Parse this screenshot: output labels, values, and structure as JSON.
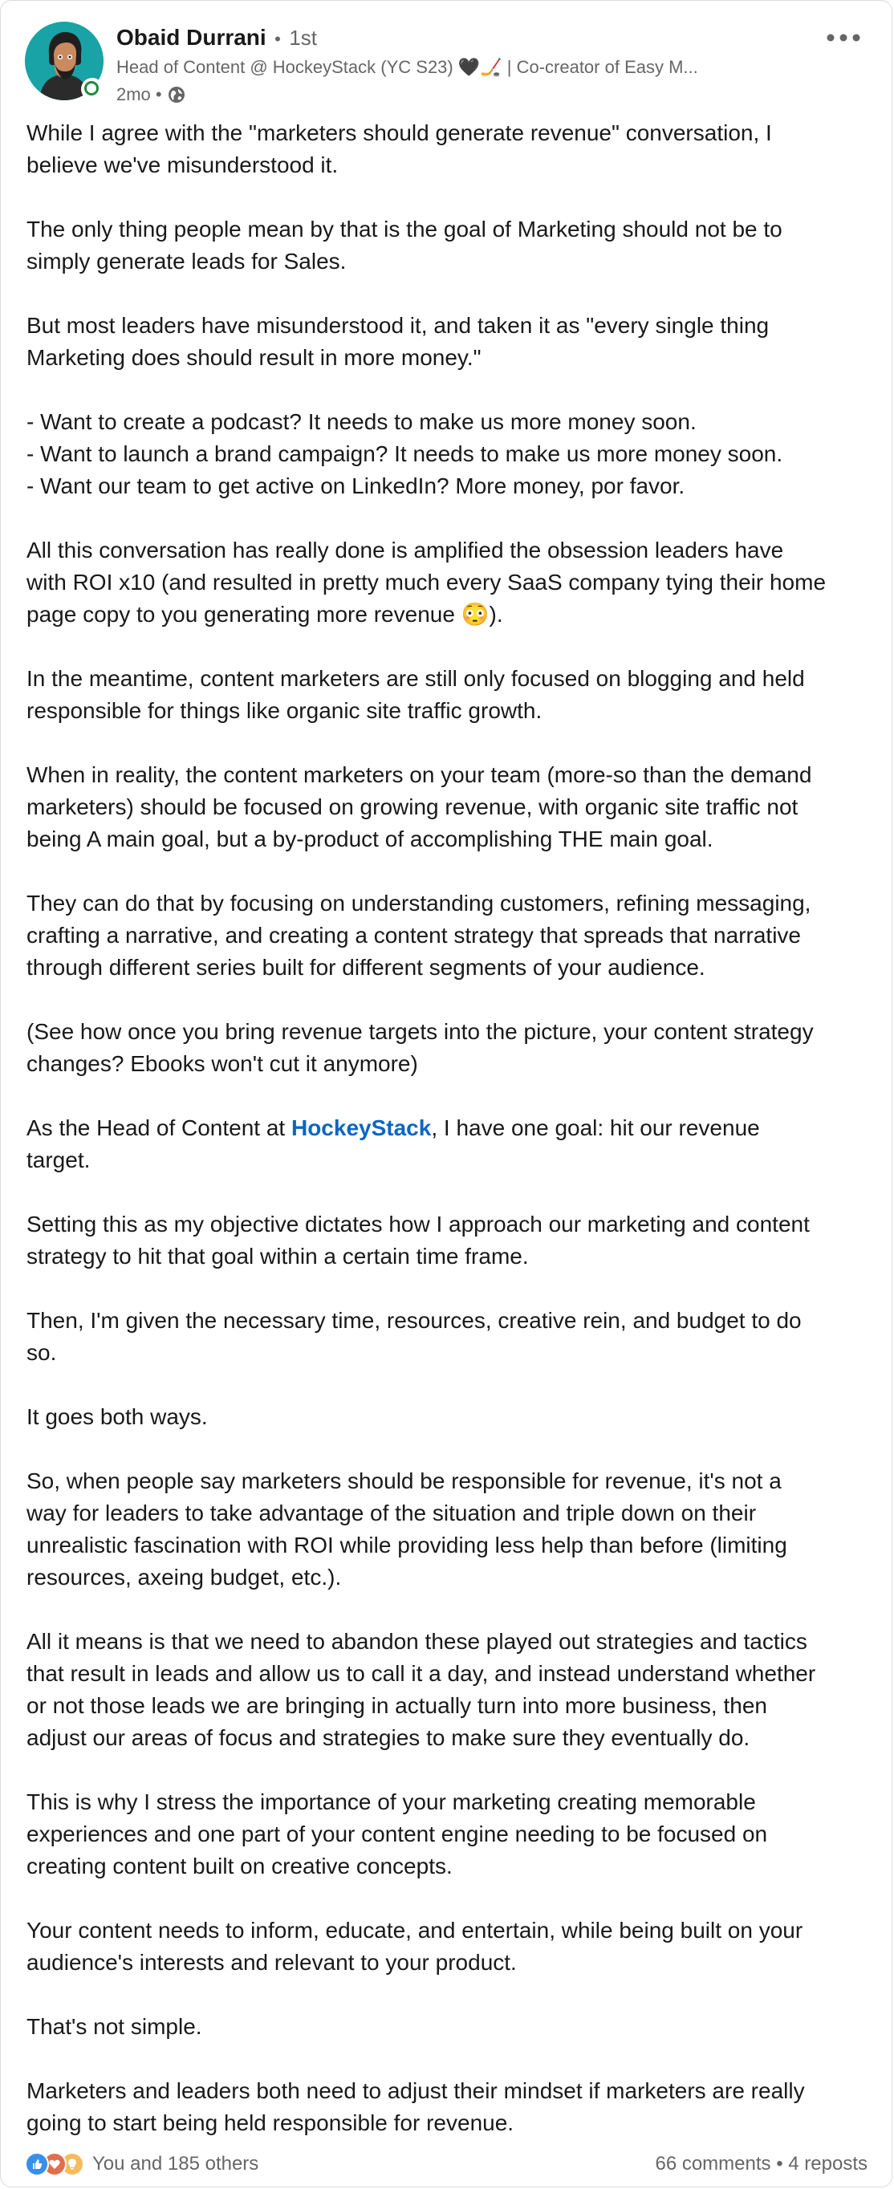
{
  "post": {
    "author": {
      "name": "Obaid Durrani",
      "separator": "•",
      "degree": "1st",
      "headline": "Head of Content @ HockeyStack (YC S23) 🖤🏒 | Co-creator of Easy M...",
      "time": "2mo •",
      "visibility_icon": "globe-icon",
      "presence_color": "#1e8a3f",
      "avatar_bg": "#19a3a6"
    },
    "paragraphs": [
      "While I agree with the \"marketers should generate revenue\" conversation, I\nbelieve we've misunderstood it.",
      "The only thing people mean by that is the goal of Marketing should not be to\nsimply generate leads for Sales.",
      "But most leaders have misunderstood it, and taken it as \"every single thing\nMarketing does should result in more money.\"",
      "- Want to create a podcast? It needs to make us more money soon.\n- Want to launch a brand campaign? It needs to make us more money soon.\n- Want our team to get active on LinkedIn? More money, por favor.",
      "All this conversation has really done is amplified the obsession leaders have\nwith ROI x10 (and resulted in pretty much every SaaS company tying their home\npage copy to you generating more revenue 😳).",
      "In the meantime, content marketers are still only focused on blogging and held\nresponsible for things like organic site traffic growth.",
      "When in reality, the content marketers on your team (more-so than the demand\nmarketers) should be focused on growing revenue, with organic site traffic not\nbeing A main goal, but a by-product of accomplishing THE main goal.",
      "They can do that by focusing on understanding customers, refining messaging,\ncrafting a narrative, and creating a content strategy that spreads that narrative\nthrough different series built for different segments of your audience.",
      "(See how once you bring revenue targets into the picture, your content strategy\nchanges? Ebooks won't cut it anymore)"
    ],
    "mention_paragraph": {
      "before": "As the Head of Content at ",
      "mention": "HockeyStack",
      "after": ", I have one goal: hit our revenue\ntarget."
    },
    "paragraphs_after": [
      "Setting this as my objective dictates how I approach our marketing and content\nstrategy to hit that goal within a certain time frame.",
      "Then, I'm given the necessary time, resources, creative rein, and budget to do\nso.",
      "It goes both ways.",
      "So, when people say marketers should be responsible for revenue, it's not a\nway for leaders to take advantage of the situation and triple down on their\nunrealistic fascination with ROI while providing less help than before (limiting\nresources, axeing budget, etc.).",
      "All it means is that we need to abandon these played out strategies and tactics\nthat result in leads and allow us to call it a day, and instead understand whether\nor not those leads we are bringing in actually turn into more business, then\nadjust our areas of focus and strategies to make sure they eventually do.",
      "This is why I stress the importance of your marketing creating memorable\nexperiences and one part of your content engine needing to be focused on\ncreating content built on creative concepts.",
      "Your content needs to inform, educate, and entertain, while being built on your\naudience's interests and relevant to your product.",
      "That's not simple.",
      "Marketers and leaders both need to adjust their mindset if marketers are really\ngoing to start being held responsible for revenue."
    ],
    "footer": {
      "reaction_icons": [
        "like-icon",
        "love-icon",
        "insightful-icon"
      ],
      "reaction_text": "You and 185 others",
      "comments": "66 comments",
      "dot": "•",
      "reposts": "4 reposts"
    },
    "colors": {
      "link": "#0a66c2",
      "text": "#191919",
      "muted": "#666666",
      "like": "#378fe9",
      "love": "#df704d",
      "insightful": "#f5bb5c"
    }
  }
}
